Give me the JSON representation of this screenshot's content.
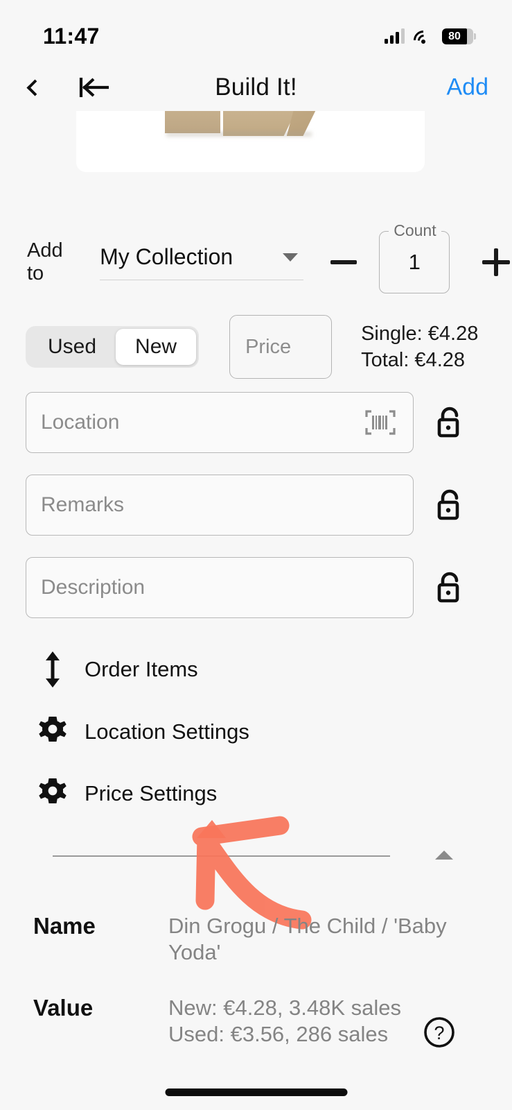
{
  "status_bar": {
    "time": "11:47",
    "battery_level": "80",
    "battery_percent": 80,
    "signal_icon": "cellular-signal-icon",
    "wifi_icon": "wifi-icon",
    "battery_icon": "battery-icon"
  },
  "nav": {
    "back_icon": "chevron-left-icon",
    "first_page_icon": "arrow-to-line-left-icon",
    "title": "Build It!",
    "add_label": "Add"
  },
  "hero": {
    "image_alt": "product-photo-tan-bricks"
  },
  "add_to": {
    "label": "Add to",
    "collection_value": "My Collection",
    "dropdown_icon": "caret-down-icon",
    "minus_icon": "minus-icon",
    "plus_icon": "plus-icon",
    "count_legend": "Count",
    "count_value": "1"
  },
  "condition": {
    "options": [
      "Used",
      "New"
    ],
    "selected": "New"
  },
  "price": {
    "placeholder": "Price",
    "value": "",
    "single": "Single: €4.28",
    "total": "Total: €4.28"
  },
  "fields": [
    {
      "name": "location",
      "placeholder": "Location",
      "value": "",
      "trailing_icon": "barcode-scan-icon",
      "lock_icon": "unlock-icon"
    },
    {
      "name": "remarks",
      "placeholder": "Remarks",
      "value": "",
      "trailing_icon": "",
      "lock_icon": "unlock-icon"
    },
    {
      "name": "description",
      "placeholder": "Description",
      "value": "",
      "trailing_icon": "",
      "lock_icon": "unlock-icon"
    }
  ],
  "actions": [
    {
      "label": "Order Items",
      "icon": "arrows-up-down-icon"
    },
    {
      "label": "Location Settings",
      "icon": "gear-icon"
    },
    {
      "label": "Price Settings",
      "icon": "gear-icon"
    }
  ],
  "collapse": {
    "icon": "triangle-up-icon"
  },
  "details": [
    {
      "key": "Name",
      "value": "Din Grogu / The Child / 'Baby Yoda'"
    },
    {
      "key": "Value",
      "value": "New: €4.28, 3.48K sales\nUsed: €3.56, 286 sales"
    }
  ],
  "help": {
    "icon": "question-mark-circle-icon"
  },
  "annotation": {
    "shape": "hand-drawn-arrow-pointing-up-left",
    "color": "#f9755a"
  },
  "colors": {
    "background": "#f7f7f7",
    "accent_blue": "#1f8cf5",
    "annotation_red": "#f9755a",
    "placeholder_gray": "#8b8b8b",
    "value_gray": "#848484"
  }
}
